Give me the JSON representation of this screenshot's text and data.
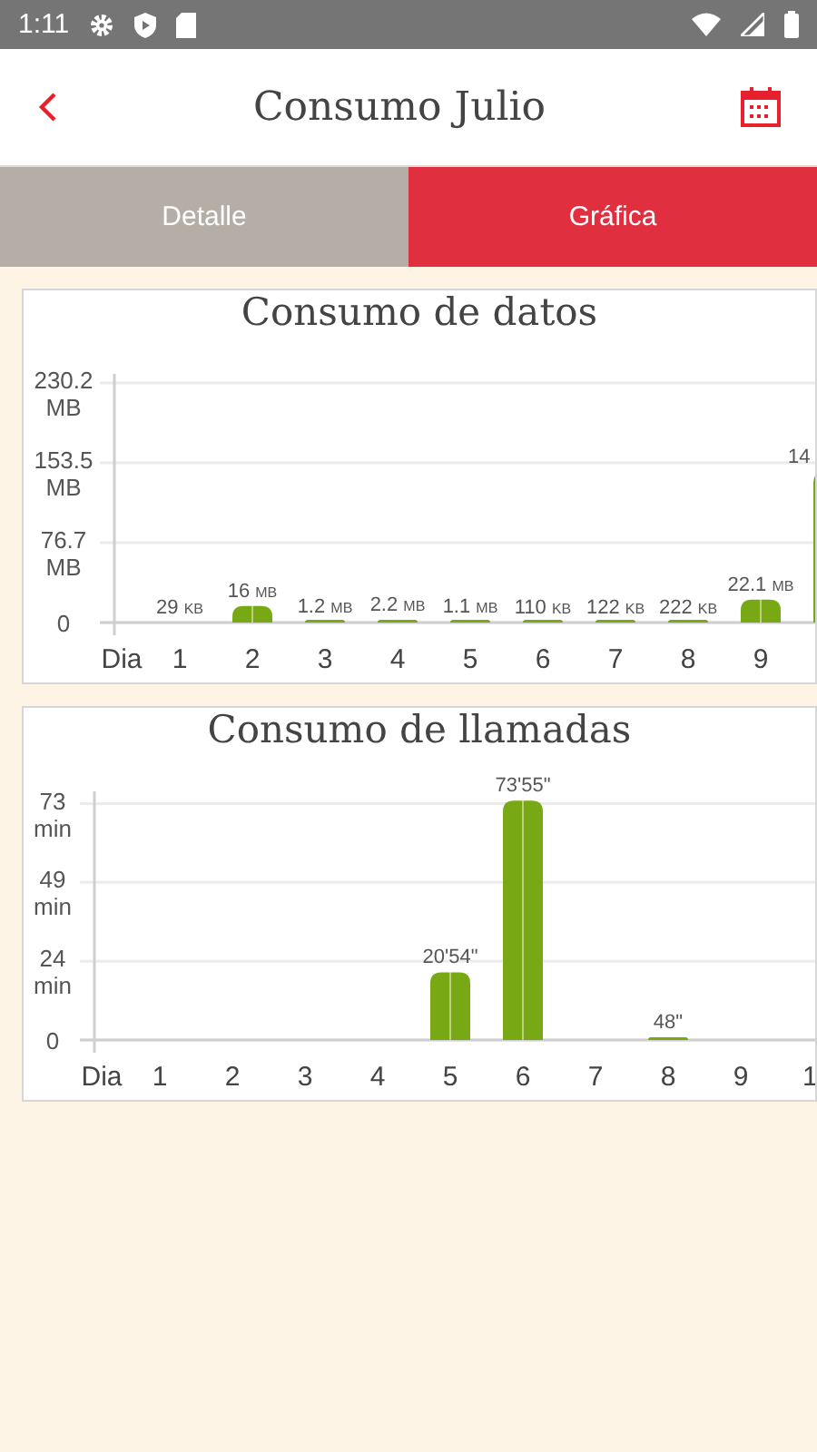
{
  "status_bar": {
    "time": "1:11"
  },
  "header": {
    "title": "Consumo Julio"
  },
  "tabs": [
    {
      "label": "Detalle",
      "selected": false
    },
    {
      "label": "Gráfica",
      "selected": true
    }
  ],
  "charts": [
    {
      "chart_data": {
        "type": "bar",
        "title": "Consumo de datos",
        "xlabel": "Dia",
        "categories": [
          "1",
          "2",
          "3",
          "4",
          "5",
          "6",
          "7",
          "8",
          "9",
          null
        ],
        "series": [
          {
            "color": "#78a814",
            "values": [
              0,
              16,
              1.2,
              2.2,
              1.1,
              0.1,
              0.1,
              0.2,
              22.1,
              145
            ]
          }
        ],
        "ylim": [
          0,
          230.2
        ],
        "yticks": [
          {
            "value": 0,
            "label": "0"
          },
          {
            "value": 76.7,
            "label": "76.7 MB"
          },
          {
            "value": 153.5,
            "label": "153.5 MB"
          },
          {
            "value": 230.2,
            "label": "230.2 MB"
          }
        ],
        "value_labels": [
          "29 KB",
          "16 MB",
          "1.2 MB",
          "2.2 MB",
          "1.1 MB",
          "110 KB",
          "122 KB",
          "222 KB",
          "22.1 MB",
          "14"
        ]
      }
    },
    {
      "chart_data": {
        "type": "bar",
        "title": "Consumo de llamadas",
        "xlabel": "Dia",
        "categories": [
          "1",
          "2",
          "3",
          "4",
          "5",
          "6",
          "7",
          "8",
          "9",
          "1"
        ],
        "series": [
          {
            "color": "#78a814",
            "values": [
              0,
              0,
              0,
              0,
              20.9,
              73.9,
              0,
              0.8,
              0,
              0
            ]
          }
        ],
        "ylim": [
          0,
          74
        ],
        "yticks": [
          {
            "value": 0,
            "label": "0"
          },
          {
            "value": 24.3,
            "label": "24 min"
          },
          {
            "value": 48.7,
            "label": "49 min"
          },
          {
            "value": 73,
            "label": "73 min"
          }
        ],
        "value_labels": [
          null,
          null,
          null,
          null,
          "20'54\"",
          "73'55\"",
          null,
          "48\"",
          null,
          null
        ]
      }
    }
  ]
}
